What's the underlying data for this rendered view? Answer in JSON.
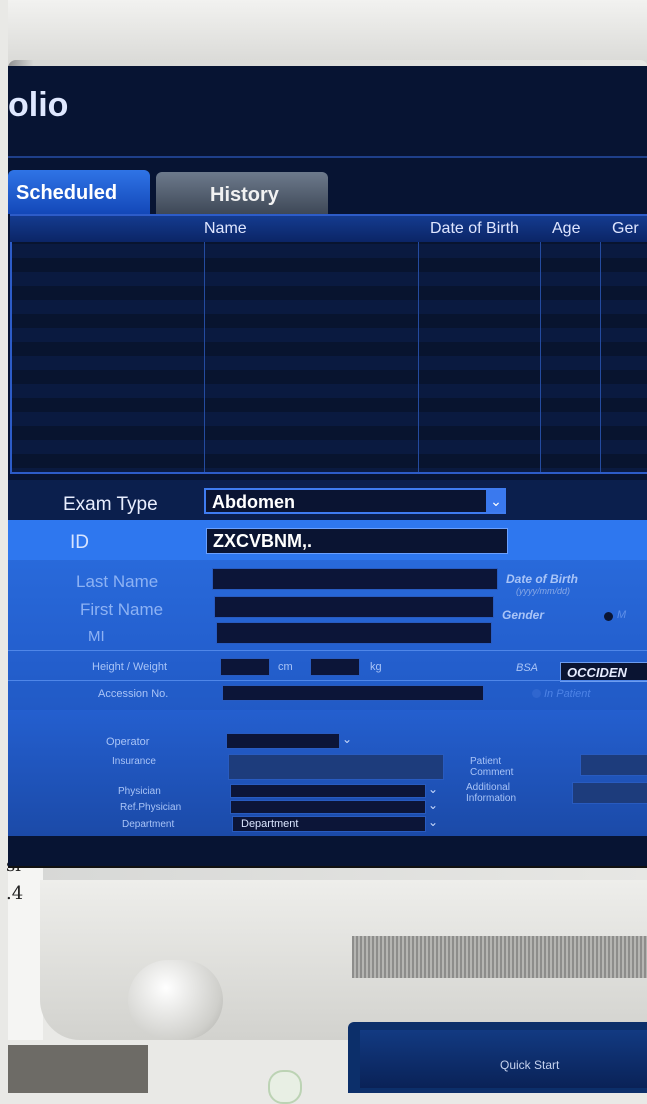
{
  "header": {
    "app_title": "olio"
  },
  "tabs": [
    {
      "label": "Scheduled",
      "active": true
    },
    {
      "label": "History",
      "active": false
    }
  ],
  "patient_list": {
    "columns": [
      "Name",
      "Date of Birth",
      "Age",
      "Ger"
    ],
    "rows": []
  },
  "form": {
    "exam_type_label": "Exam Type",
    "exam_type_value": "Abdomen",
    "id_label": "ID",
    "id_value": "ZXCVBNM,.",
    "last_name_label": "Last Name",
    "first_name_label": "First Name",
    "mi_label": "MI",
    "dob_label": "Date of Birth",
    "dob_hint": "(yyyy/mm/dd)",
    "gender_label": "Gender",
    "gender_option_partial": "M",
    "height_weight_label": "Height / Weight",
    "height_unit": "cm",
    "weight_unit": "kg",
    "bsa_label": "BSA",
    "bsa_value": "OCCIDEN",
    "accession_label": "Accession No.",
    "in_patient_label": "In Patient",
    "operator_label": "Operator",
    "insurance_label": "Insurance",
    "patient_comment_label": "Patient Comment",
    "physician_label": "Physician",
    "additional_info_label": "Additional Information",
    "ref_physician_label": "Ref.Physician",
    "department_label": "Department",
    "department_value": "Department"
  },
  "console": {
    "quick_start_label": "Quick Start"
  },
  "note": {
    "text": "sl\n.4"
  },
  "colors": {
    "accent": "#2e77ef",
    "screen_bg": "#071433",
    "field_bg": "#0a1432"
  },
  "icons": [
    "chevron-down-icon",
    "radio-icon"
  ]
}
